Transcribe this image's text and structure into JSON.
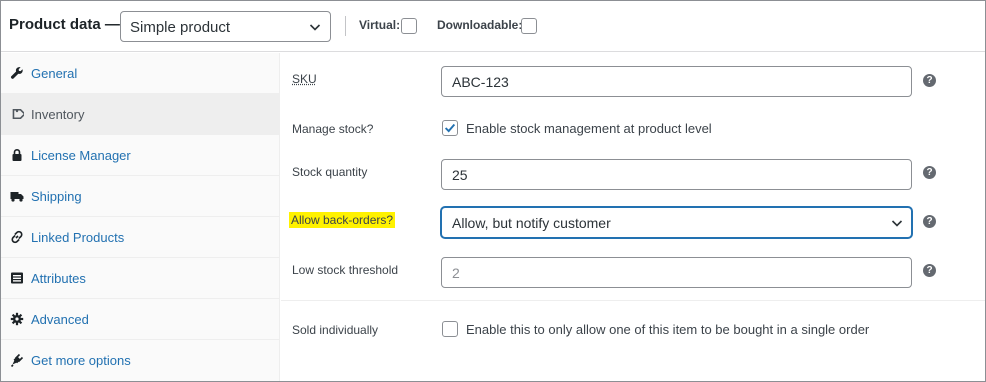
{
  "header": {
    "title": "Product data —",
    "product_type": "Simple product",
    "virtual_label": "Virtual:",
    "downloadable_label": "Downloadable:"
  },
  "sidebar": {
    "items": [
      {
        "label": "General",
        "icon": "wrench-icon"
      },
      {
        "label": "Inventory",
        "icon": "tag-icon"
      },
      {
        "label": "License Manager",
        "icon": "lock-icon"
      },
      {
        "label": "Shipping",
        "icon": "truck-icon"
      },
      {
        "label": "Linked Products",
        "icon": "link-icon"
      },
      {
        "label": "Attributes",
        "icon": "list-icon"
      },
      {
        "label": "Advanced",
        "icon": "gear-icon"
      },
      {
        "label": "Get more options",
        "icon": "plugin-icon"
      }
    ],
    "active": "Inventory"
  },
  "form": {
    "sku_label": "SKU",
    "sku_value": "ABC-123",
    "manage_stock_label": "Manage stock?",
    "manage_stock_text": "Enable stock management at product level",
    "manage_stock_checked": true,
    "stock_qty_label": "Stock quantity",
    "stock_qty_value": "25",
    "backorders_label": "Allow back-orders?",
    "backorders_value": "Allow, but notify customer",
    "low_stock_label": "Low stock threshold",
    "low_stock_placeholder": "2",
    "sold_individually_label": "Sold individually",
    "sold_individually_text": "Enable this to only allow one of this item to be bought in a single order",
    "help_glyph": "?"
  },
  "colors": {
    "accent": "#2271b1",
    "highlight": "#fff200"
  }
}
